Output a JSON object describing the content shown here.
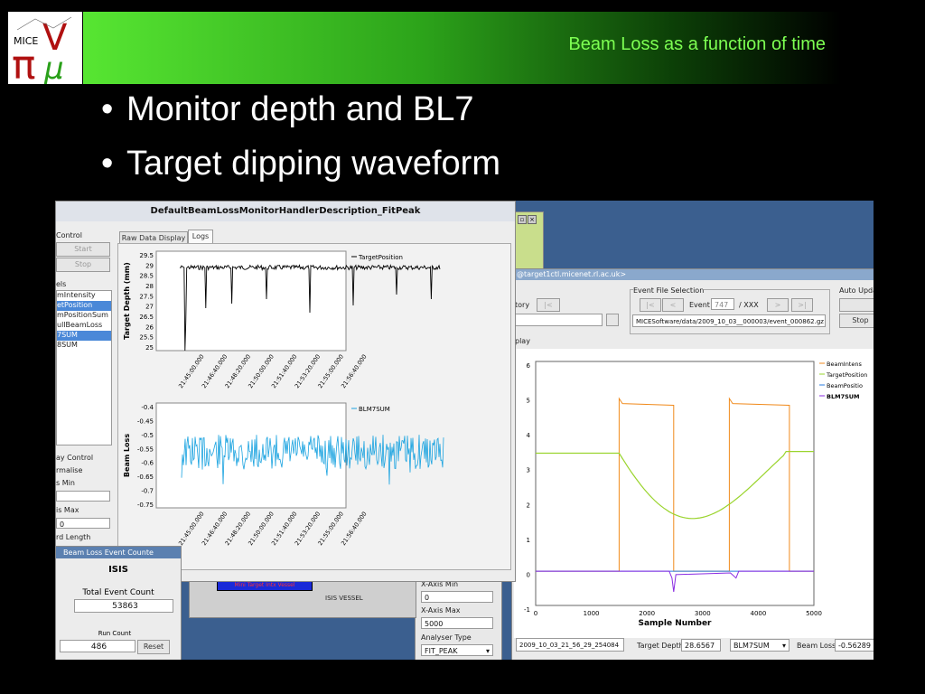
{
  "slide": {
    "title": "Beam Loss as a function of time",
    "bullets": [
      "Monitor depth and BL7",
      "Target dipping waveform"
    ],
    "logo_text": "MICE"
  },
  "colors": {
    "header_green": "#57e632",
    "title_text": "#7dff52"
  },
  "main_window": {
    "title": "DefaultBeamLossMonitorHandlerDescription_FitPeak",
    "tabs": [
      "Raw Data Display",
      "Logs"
    ],
    "control_group": "Control",
    "start_label": "Start",
    "stop_label": "Stop",
    "list_label": "els",
    "channels": [
      "mIntensity",
      "etPosition",
      "mPositionSum",
      "ullBeamLoss",
      "7SUM",
      "8SUM"
    ],
    "display_control": "ay Control",
    "normalise": "rmalise",
    "axis_min": "s Min",
    "axis_max": "is Max",
    "axis_max_value": "0",
    "record_length": "rd Length"
  },
  "top_plot": {
    "legend": "TargetPosition",
    "ylabel": "Target Depth (mm)",
    "yticks": [
      "29.5",
      "29",
      "28.5",
      "28",
      "27.5",
      "27",
      "26.5",
      "26",
      "25.5",
      "25"
    ],
    "xticks": [
      "21:45:00.000",
      "21:46:40.000",
      "21:48:20.000",
      "21:50:00.000",
      "21:51:40.000",
      "21:53:20.000",
      "21:55:00.000",
      "21:56:40.000"
    ]
  },
  "bottom_plot": {
    "legend": "BLM7SUM",
    "ylabel": "Beam Loss",
    "yticks": [
      "-0.4",
      "-0.45",
      "-0.5",
      "-0.55",
      "-0.6",
      "-0.65",
      "-0.7",
      "-0.75"
    ],
    "xticks": [
      "21:45:00.000",
      "21:46:40.000",
      "21:48:20.000",
      "21:50:00.000",
      "21:51:40.000",
      "21:53:20.000",
      "21:55:00.000",
      "21:56:40.000"
    ]
  },
  "count_window": {
    "title": "Beam Loss Event Counte",
    "heading": "ISIS",
    "total_label": "Total Event Count",
    "total_value": "53863",
    "run_label": "Run Count",
    "run_value": "486",
    "reset_label": "Reset"
  },
  "vessel": {
    "label": "ISIS VESSEL",
    "bar_text": "Mini Target Intx Vessel"
  },
  "right_window": {
    "title": "@target1ctl.micenet.rl.ac.uk>",
    "event_file": "Event File Selection",
    "history": "tory",
    "event_label": "Event",
    "event_value": "747",
    "event_total": "/ XXX",
    "file_path": "MICESoftware/data/2009_10_03__000003/event_000862.gz",
    "auto_update": "Auto Upda",
    "stop": "Stop",
    "display": "play",
    "xaxis_min_label": "X-Axis Min",
    "xaxis_min_value": "0",
    "xaxis_max_label": "X-Axis Max",
    "xaxis_max_value": "5000",
    "analyser_label": "Analyser Type",
    "analyser_value": "FIT_PEAK",
    "status_file": "2009_10_03_21_56_29_254084",
    "target_depth_label": "Target Depth",
    "target_depth_value": "28.6567",
    "blm_select": "BLM7SUM",
    "beam_loss_label": "Beam Loss",
    "beam_loss_value": "-0.56289",
    "xlabel": "Sample Number",
    "xticks": [
      "0",
      "1000",
      "2000",
      "3000",
      "4000",
      "5000"
    ],
    "yticks": [
      "6",
      "5",
      "4",
      "3",
      "2",
      "1",
      "0",
      "-1"
    ],
    "legend": [
      "BeamIntens",
      "TargetPosition",
      "BeamPositio",
      "BLM7SUM"
    ]
  }
}
